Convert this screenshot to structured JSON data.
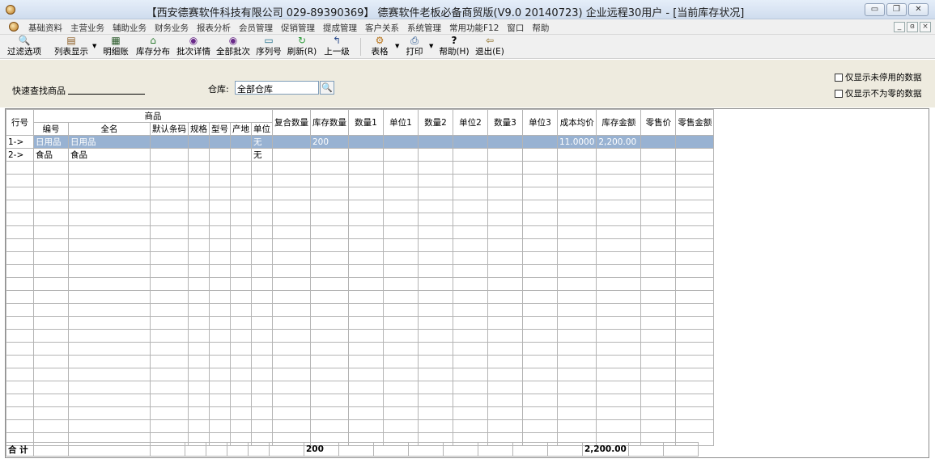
{
  "window": {
    "title": "【西安德赛软件科技有限公司 029-89390369】 德赛软件老板必备商贸版(V9.0 20140723) 企业远程30用户 - [当前库存状况]",
    "min_glyph": "▭",
    "max_glyph": "❐",
    "close_glyph": "✕"
  },
  "menu": {
    "items": [
      "基础资料",
      "主营业务",
      "辅助业务",
      "财务业务",
      "报表分析",
      "会员管理",
      "促销管理",
      "提成管理",
      "客户关系",
      "系统管理",
      "常用功能F12",
      "窗口",
      "帮助"
    ],
    "mdi_min": "_",
    "mdi_restore": "ɞ",
    "mdi_close": "×"
  },
  "toolbar": {
    "filter": "过滤选项",
    "list_display": "列表显示",
    "detail": "明细账",
    "stock_dist": "库存分布",
    "batch_detail": "批次详情",
    "all_batches": "全部批次",
    "serial": "序列号",
    "refresh": "刷新(R)",
    "up_level": "上一级",
    "table": "表格",
    "print": "打印",
    "help": "帮助(H)",
    "exit": "退出(E)",
    "icons": {
      "filter": "🔍",
      "list_display": "▤",
      "detail": "▦",
      "stock_dist": "⌂",
      "batch_detail": "◉",
      "all_batches": "◉",
      "serial": "▭",
      "refresh": "↻",
      "up_level": "↰",
      "table": "⚙",
      "print": "⎙",
      "help": "?",
      "exit": "⇦"
    },
    "arrow": "▼"
  },
  "filter": {
    "quick_find_label": "快速查找商品",
    "warehouse_label": "仓库:",
    "warehouse_value": "全部仓库",
    "search_glyph": "🔍",
    "only_active": "仅显示未停用的数据",
    "only_nonzero": "仅显示不为零的数据"
  },
  "grid": {
    "header_row_no": "行号",
    "header_goods": "商品",
    "sub_headers": [
      "编号",
      "全名",
      "默认条码",
      "规格",
      "型号",
      "产地",
      "单位"
    ],
    "headers": [
      "复合数量",
      "库存数量",
      "数量1",
      "单位1",
      "数量2",
      "单位2",
      "数量3",
      "单位3",
      "成本均价",
      "库存金额",
      "零售价",
      "零售金额"
    ],
    "rows": [
      {
        "no": "1->",
        "code": "日用品",
        "name": "日用品",
        "barcode": "",
        "spec": "",
        "model": "",
        "origin": "",
        "unit": "无",
        "composite_qty": "",
        "stock_qty": "200",
        "qty1": "",
        "unit1": "",
        "qty2": "",
        "unit2": "",
        "qty3": "",
        "unit3": "",
        "avg_cost": "11.0000",
        "stock_amount": "2,200.00",
        "retail_price": "",
        "retail_amount": ""
      },
      {
        "no": "2->",
        "code": "食品",
        "name": "食品",
        "barcode": "",
        "spec": "",
        "model": "",
        "origin": "",
        "unit": "无",
        "composite_qty": "",
        "stock_qty": "",
        "qty1": "",
        "unit1": "",
        "qty2": "",
        "unit2": "",
        "qty3": "",
        "unit3": "",
        "avg_cost": "",
        "stock_amount": "",
        "retail_price": "",
        "retail_amount": ""
      }
    ],
    "total_label": "合 计",
    "total_stock_qty": "200",
    "total_stock_amount": "2,200.00"
  }
}
